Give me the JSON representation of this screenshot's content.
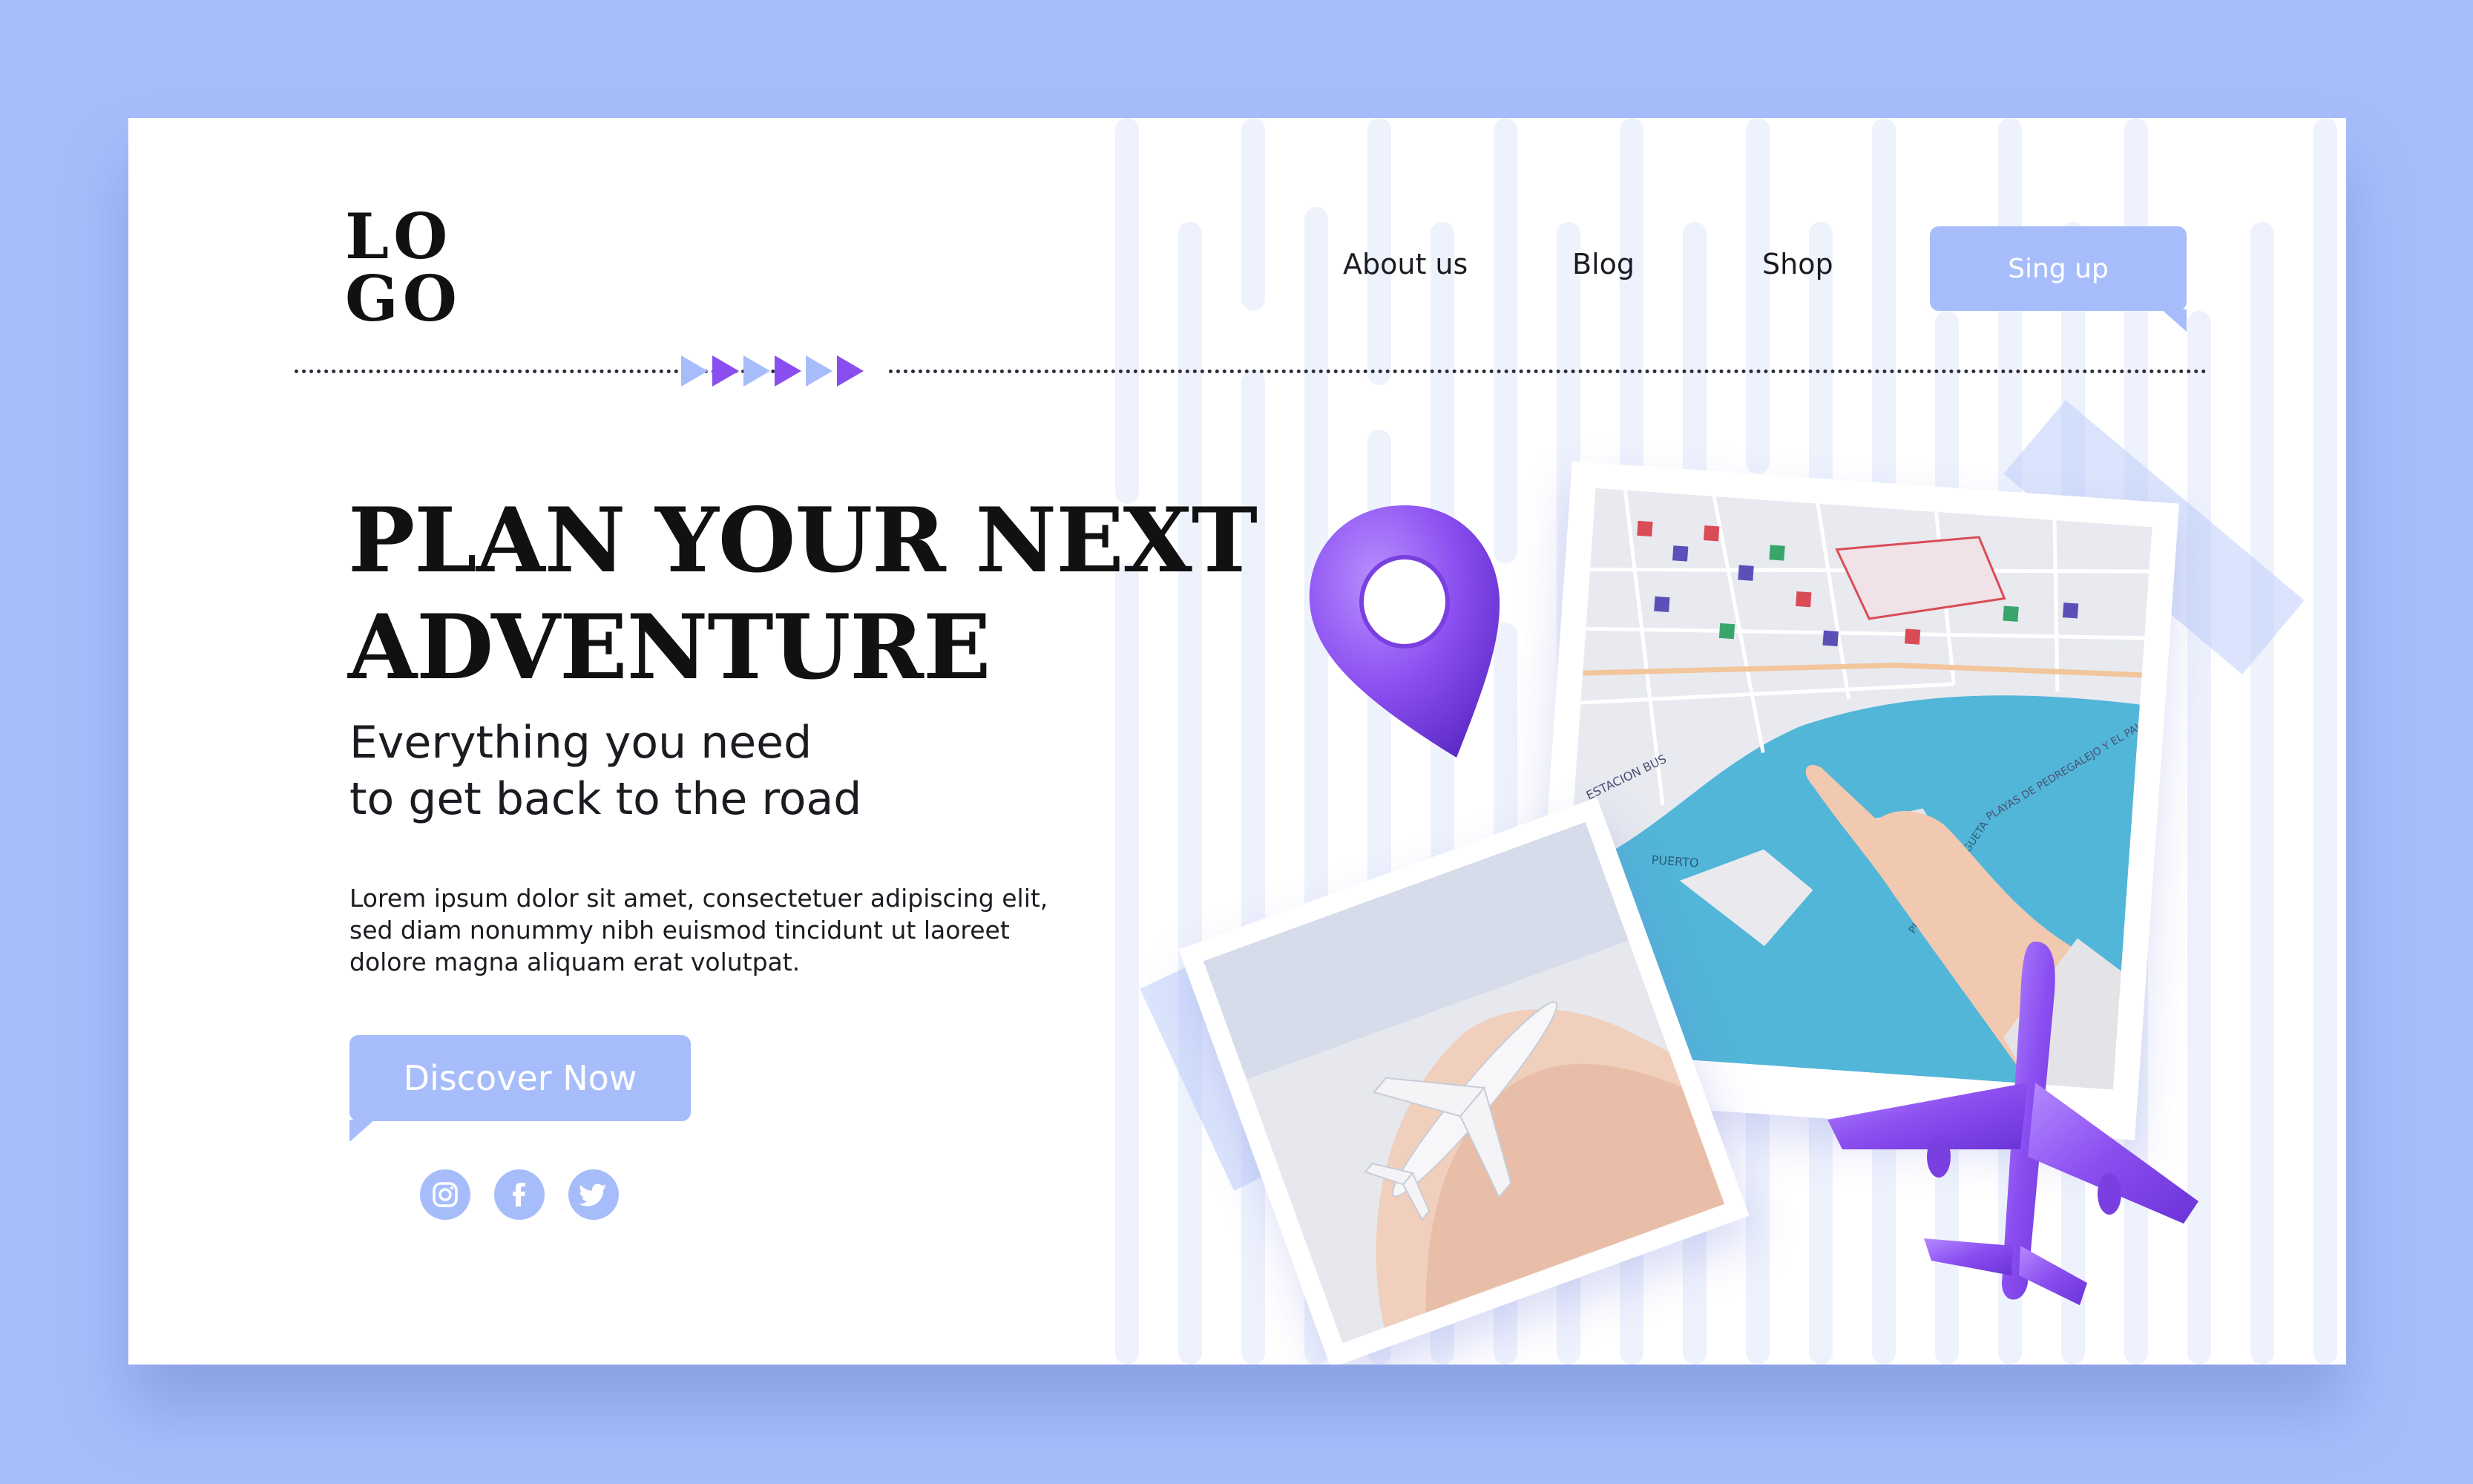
{
  "brand": {
    "logo_line1": "LO",
    "logo_line2": "GO"
  },
  "nav": {
    "about": "About us",
    "blog": "Blog",
    "shop": "Shop",
    "signup": "Sing up"
  },
  "hero": {
    "headline_line1": "PLAN YOUR NEXT",
    "headline_line2": "ADVENTURE",
    "sub_line1": "Everything you need",
    "sub_line2": "to get back to the road",
    "body_line1": "Lorem ipsum dolor sit amet, consectetuer adipiscing elit,",
    "body_line2": "sed diam nonummy nibh euismod tincidunt ut laoreet",
    "body_line3": "dolore magna aliquam erat volutpat.",
    "cta": "Discover Now"
  },
  "social": [
    "instagram-icon",
    "facebook-icon",
    "twitter-icon"
  ],
  "map_labels": {
    "estacion": "ESTACION BUS",
    "puerto": "PUERTO",
    "malagueta": "PLAYA DE LA MALAGUETA",
    "pedregalejo": "PLAYAS DE PEDREGALEJO Y EL PALO"
  },
  "colors": {
    "background": "#a7bdfb",
    "accent": "#a7bdfb",
    "purple": "#8a4df0",
    "text": "#111111"
  }
}
